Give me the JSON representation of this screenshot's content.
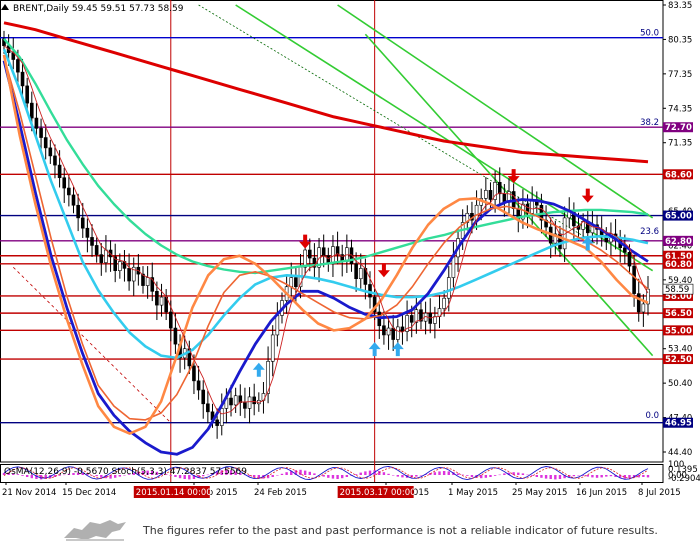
{
  "chart_data": {
    "type": "candlestick",
    "symbol": "BRENT,Daily",
    "ohlc_header": "59.45 59.51 57.73 58.59",
    "current_price": "58.59",
    "ylim": [
      44.4,
      83.35
    ],
    "y_ticks": [
      "83.35",
      "80.35",
      "77.35",
      "74.35",
      "71.35",
      "68.40",
      "65.40",
      "62.40",
      "59.40",
      "56.40",
      "53.40",
      "50.40",
      "47.40",
      "44.40"
    ],
    "x_labels": [
      "21 Nov 2014",
      "15 Dec 2014",
      "2 Feb 2015",
      "24 Feb 2015",
      "9 Apr 2015",
      "1 May 2015",
      "25 May 2015",
      "16 Jun 2015",
      "8 Jul 2015"
    ],
    "highlighted_dates": [
      "2015.01.14 00:00",
      "2015.03.17 00:00"
    ],
    "levels": [
      {
        "value": 80.5,
        "label": "",
        "color": "#0000cc"
      },
      {
        "value": 72.7,
        "label": "72.70",
        "color": "#800080"
      },
      {
        "value": 68.6,
        "label": "68.60",
        "color": "#c00000"
      },
      {
        "value": 65.0,
        "label": "65.00",
        "color": "#000080"
      },
      {
        "value": 62.8,
        "label": "62.80",
        "color": "#800080"
      },
      {
        "value": 61.5,
        "label": "61.50",
        "color": "#c00000"
      },
      {
        "value": 60.8,
        "label": "60.80",
        "color": "#c00000"
      },
      {
        "value": 58.0,
        "label": "58.00",
        "color": "#c00000"
      },
      {
        "value": 56.5,
        "label": "56.50",
        "color": "#c00000"
      },
      {
        "value": 55.0,
        "label": "55.00",
        "color": "#c00000"
      },
      {
        "value": 52.5,
        "label": "52.50",
        "color": "#c00000"
      },
      {
        "value": 46.95,
        "label": "46.95",
        "color": "#000080"
      }
    ],
    "fib_labels": [
      {
        "text": "50.0",
        "value": 80.5
      },
      {
        "text": "38.2",
        "value": 72.7
      },
      {
        "text": "23.6",
        "value": 63.2
      },
      {
        "text": "0.0",
        "value": 47.2
      }
    ],
    "closes": [
      79.8,
      79.2,
      78.6,
      77.5,
      76.3,
      74.8,
      73.5,
      72.6,
      71.8,
      70.9,
      70.2,
      69.4,
      68.3,
      67.4,
      66.8,
      65.9,
      64.8,
      63.9,
      63.1,
      62.4,
      61.6,
      60.9,
      62.0,
      61.4,
      60.2,
      61.0,
      60.4,
      59.3,
      60.5,
      59.9,
      58.9,
      59.6,
      58.4,
      57.2,
      57.9,
      56.6,
      55.2,
      53.8,
      52.6,
      53.4,
      51.9,
      50.6,
      49.8,
      48.6,
      47.9,
      47.2,
      46.7,
      48.2,
      49.1,
      48.5,
      49.3,
      48.7,
      48.2,
      49.2,
      48.6,
      48.9,
      49.5,
      52.3,
      54.6,
      56.3,
      57.6,
      58.8,
      59.6,
      58.8,
      60.5,
      62.0,
      61.3,
      60.5,
      62.2,
      61.5,
      60.8,
      62.3,
      61.6,
      61.0,
      62.2,
      60.8,
      59.5,
      60.4,
      59.0,
      57.9,
      56.6,
      55.4,
      54.6,
      55.2,
      54.2,
      55.3,
      54.9,
      56.3,
      55.7,
      56.8,
      55.8,
      56.5,
      55.6,
      56.2,
      56.9,
      57.8,
      59.6,
      61.4,
      63.0,
      64.4,
      65.2,
      64.6,
      65.9,
      66.5,
      67.2,
      66.4,
      67.9,
      66.9,
      66.2,
      67.1,
      65.6,
      64.7,
      66.0,
      65.2,
      66.4,
      65.9,
      64.6,
      64.0,
      62.6,
      63.4,
      62.1,
      64.8,
      65.3,
      64.1,
      63.8,
      64.5,
      63.5,
      64.2,
      63.8,
      63.3,
      62.7,
      63.4,
      62.9,
      62.2,
      61.8,
      60.6,
      58.2,
      56.6,
      57.3,
      58.59
    ],
    "series": [
      {
        "values": [
          81.8,
          81.5,
          81.2,
          80.8,
          80.4,
          80.0,
          79.6,
          79.2,
          78.8,
          78.4,
          78.0,
          77.6,
          77.2,
          76.8,
          76.4,
          76.0,
          75.6,
          75.2,
          74.8,
          74.4,
          74.0,
          73.6,
          73.3,
          73.0,
          72.7,
          72.4,
          72.1,
          71.8,
          71.5,
          71.3,
          71.1,
          70.9,
          70.7,
          70.5,
          70.4,
          70.3,
          70.2,
          70.1,
          70.0,
          69.9,
          69.8,
          69.7
        ]
      },
      {
        "values": [
          80.4,
          78.8,
          76.5,
          74.0,
          71.6,
          69.5,
          67.6,
          66.0,
          64.6,
          63.4,
          62.4,
          61.6,
          61.0,
          60.6,
          60.3,
          60.1,
          60.0,
          60.2,
          60.4,
          60.6,
          60.7,
          60.9,
          61.1,
          61.4,
          61.8,
          62.2,
          62.6,
          63.0,
          63.3,
          63.7,
          64.0,
          64.3,
          64.6,
          64.9,
          65.1,
          65.3,
          65.4,
          65.5,
          65.5,
          65.4,
          65.3,
          65.1
        ]
      },
      {
        "values": [
          79.5,
          76.0,
          72.0,
          68.0,
          64.5,
          61.0,
          58.5,
          56.5,
          54.8,
          53.6,
          52.8,
          52.6,
          53.3,
          54.6,
          56.3,
          57.8,
          59.0,
          59.6,
          59.8,
          59.7,
          59.5,
          59.2,
          58.8,
          58.4,
          58.1,
          57.9,
          57.9,
          58.0,
          58.3,
          58.8,
          59.4,
          60.0,
          60.6,
          61.2,
          61.8,
          62.4,
          62.8,
          63.1,
          63.2,
          63.1,
          62.9,
          62.6
        ]
      },
      {
        "values": [
          78.5,
          73.0,
          67.0,
          61.5,
          57.0,
          53.0,
          49.5,
          47.6,
          46.2,
          45.2,
          44.4,
          44.2,
          44.8,
          46.4,
          48.8,
          51.4,
          53.8,
          55.8,
          57.3,
          58.4,
          58.4,
          57.8,
          57.0,
          56.4,
          56.1,
          56.2,
          56.8,
          58.2,
          60.2,
          62.4,
          64.4,
          65.6,
          66.2,
          66.4,
          66.3,
          66.0,
          65.4,
          64.6,
          63.8,
          62.9,
          61.9,
          61.0
        ]
      },
      {
        "values": [
          78.8,
          74.0,
          68.5,
          63.0,
          58.0,
          53.8,
          50.2,
          48.4,
          47.3,
          47.2,
          47.8,
          49.4,
          52.0,
          55.4,
          58.3,
          59.8,
          60.1,
          59.7,
          59.0,
          58.2,
          57.4,
          56.6,
          56.1,
          56.0,
          56.3,
          57.2,
          58.8,
          60.8,
          62.6,
          64.0,
          65.0,
          65.6,
          65.8,
          65.5,
          64.9,
          64.2,
          63.5,
          62.8,
          62.0,
          61.0,
          59.8,
          58.6
        ]
      },
      {
        "values": [
          79.0,
          72.0,
          66.0,
          60.6,
          56.0,
          52.0,
          48.4,
          46.6,
          46.0,
          46.6,
          48.8,
          52.8,
          57.0,
          59.8,
          61.2,
          61.5,
          60.8,
          59.6,
          58.2,
          56.8,
          55.6,
          55.0,
          55.2,
          56.0,
          57.6,
          59.8,
          62.2,
          64.2,
          65.6,
          66.4,
          66.5,
          66.0,
          65.2,
          64.4,
          63.8,
          63.3,
          62.8,
          62.2,
          61.0,
          59.4,
          58.0,
          57.4
        ]
      }
    ],
    "down_arrows": [
      {
        "index": 65,
        "value": 62.3
      },
      {
        "index": 82,
        "value": 59.8
      },
      {
        "index": 110,
        "value": 68.0
      },
      {
        "index": 126,
        "value": 66.3
      }
    ],
    "up_arrows": [
      {
        "index": 55,
        "value": 52.0
      },
      {
        "index": 80,
        "value": 53.8
      },
      {
        "index": 85,
        "value": 53.8
      },
      {
        "index": 126,
        "value": 63.0
      }
    ],
    "oscillator": {
      "label": "OsMA(12,26,9) -0.5670  Stoch(5,3,3) 47.2837 57.5569",
      "y_ticks": [
        "100",
        "0.1395",
        "0.00",
        "-0.2904"
      ],
      "histogram": [
        0.05,
        0.06,
        0.04,
        0.02,
        -0.02,
        -0.05,
        -0.08,
        -0.1,
        -0.11,
        -0.1,
        -0.08,
        -0.05,
        -0.02,
        0.01,
        0.03,
        0.05,
        0.06,
        0.05,
        0.03,
        0.0,
        -0.03,
        -0.06,
        -0.08,
        -0.09,
        -0.07,
        -0.04,
        -0.01,
        0.02,
        0.05,
        0.08,
        0.1,
        0.11,
        0.1,
        0.08,
        0.05,
        0.02,
        -0.02,
        -0.05,
        -0.08,
        -0.1,
        -0.11,
        -0.1,
        -0.07,
        -0.03,
        0.01,
        0.05,
        0.09,
        0.12,
        0.13,
        0.12,
        0.09,
        0.05,
        0.01,
        -0.03,
        -0.06,
        -0.08,
        -0.09,
        -0.08,
        -0.05,
        -0.01,
        0.03,
        0.07,
        0.1,
        0.12,
        0.13,
        0.11,
        0.08,
        0.04,
        0.0,
        -0.04,
        -0.07,
        -0.09,
        -0.1,
        -0.08,
        -0.05,
        -0.02,
        0.02,
        0.06,
        0.09,
        0.11,
        0.12,
        0.1,
        0.07,
        0.03,
        -0.01,
        -0.04,
        -0.06,
        -0.07,
        -0.06,
        -0.04,
        -0.01,
        0.02,
        0.05,
        0.07,
        0.09,
        0.1,
        0.09,
        0.07,
        0.04,
        0.01,
        -0.02,
        -0.05,
        -0.07,
        -0.08,
        -0.07,
        -0.05,
        -0.02,
        0.01,
        0.04,
        0.06,
        0.07,
        0.06,
        0.04,
        0.01,
        -0.02,
        -0.05,
        -0.07,
        -0.09,
        -0.1,
        -0.11,
        -0.1,
        -0.08,
        -0.05,
        -0.03,
        -0.01,
        -0.02,
        -0.04,
        -0.06,
        -0.07,
        -0.06,
        -0.04,
        -0.03,
        -0.05,
        -0.07,
        -0.09,
        -0.08,
        -0.07,
        -0.06,
        -0.05,
        -0.06
      ]
    }
  },
  "footer": {
    "disclaimer": "The figures refer to the past and past performance is not a reliable indicator of future results."
  }
}
